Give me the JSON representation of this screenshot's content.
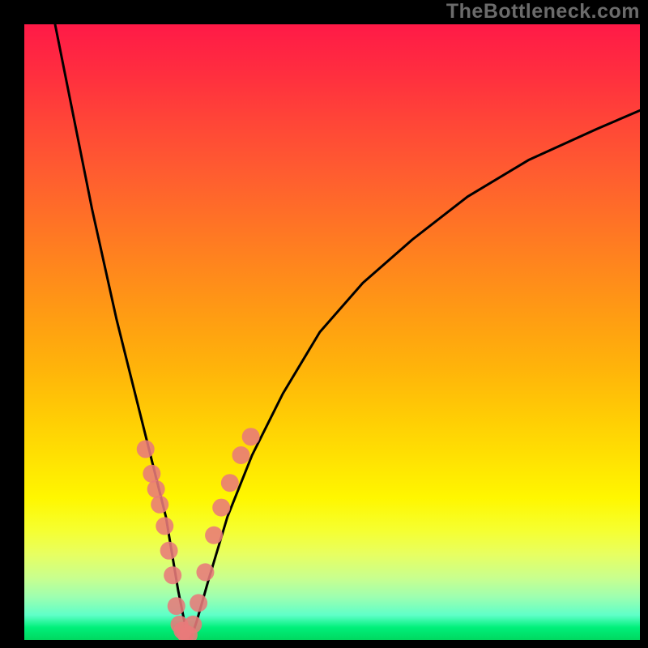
{
  "watermark": "TheBottleneck.com",
  "chart_data": {
    "type": "line",
    "title": "",
    "xlabel": "",
    "ylabel": "",
    "xlim": [
      0,
      100
    ],
    "ylim": [
      0,
      100
    ],
    "series": [
      {
        "name": "curve",
        "x": [
          5,
          7,
          9,
          11,
          13,
          15,
          17,
          19,
          21,
          23,
          24,
          25,
          26,
          27,
          28,
          30,
          33,
          37,
          42,
          48,
          55,
          63,
          72,
          82,
          93,
          100
        ],
        "y": [
          100,
          90,
          80,
          70,
          61,
          52,
          44,
          36,
          28,
          20,
          14,
          8,
          3,
          0,
          3,
          10,
          20,
          30,
          40,
          50,
          58,
          65,
          72,
          78,
          83,
          86
        ]
      }
    ],
    "scatter": {
      "name": "dots",
      "points": [
        {
          "x": 19.7,
          "y": 31
        },
        {
          "x": 20.7,
          "y": 27
        },
        {
          "x": 21.4,
          "y": 24.5
        },
        {
          "x": 22.0,
          "y": 22
        },
        {
          "x": 22.8,
          "y": 18.5
        },
        {
          "x": 23.5,
          "y": 14.5
        },
        {
          "x": 24.1,
          "y": 10.5
        },
        {
          "x": 24.7,
          "y": 5.5
        },
        {
          "x": 25.2,
          "y": 2.5
        },
        {
          "x": 25.7,
          "y": 1.5
        },
        {
          "x": 26.2,
          "y": 1.0
        },
        {
          "x": 26.7,
          "y": 0.8
        },
        {
          "x": 27.4,
          "y": 2.5
        },
        {
          "x": 28.3,
          "y": 6
        },
        {
          "x": 29.4,
          "y": 11
        },
        {
          "x": 30.8,
          "y": 17
        },
        {
          "x": 32.0,
          "y": 21.5
        },
        {
          "x": 33.4,
          "y": 25.5
        },
        {
          "x": 35.2,
          "y": 30
        },
        {
          "x": 36.8,
          "y": 33
        }
      ]
    },
    "colors": {
      "curve": "#000000",
      "dots": "#e87a7a"
    }
  }
}
